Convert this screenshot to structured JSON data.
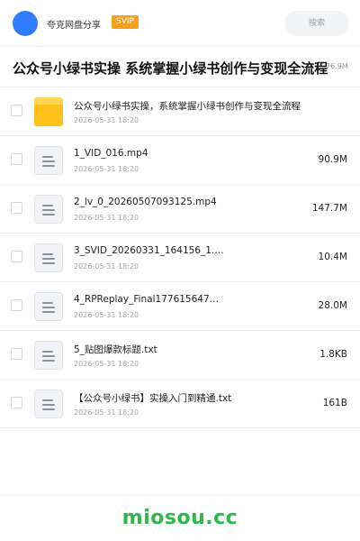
{
  "header": {
    "share_name": "夸克网盘分享",
    "badge": "SVIP",
    "search_placeholder": "搜索",
    "avatar_color": "#2f7bff",
    "badge_color": "#f5a01f"
  },
  "title": {
    "text": "公众号小绿书实操 系统掌握小绿书创作与变现全流程",
    "size": "76.9M"
  },
  "files": [
    {
      "type": "folder",
      "name": "公众号小绿书实操，系统掌握小绿书创作与变现全流程",
      "date": "2026-05-31 18:20",
      "size": ""
    },
    {
      "type": "file",
      "name": "1_VID_016.mp4",
      "date": "2026-05-31 18:20",
      "size": "90.9M"
    },
    {
      "type": "file",
      "name": "2_lv_0_20260507093125.mp4",
      "date": "2026-05-31 18:20",
      "size": "147.7M"
    },
    {
      "type": "file",
      "name": "3_SVID_20260331_164156_1.…",
      "date": "2026-05-31 18:20",
      "size": "10.4M"
    },
    {
      "type": "file",
      "name": "4_RPReplay_Final177615647…",
      "date": "2026-05-31 18:20",
      "size": "28.0M"
    },
    {
      "type": "file",
      "name": "5_贴图爆款标题.txt",
      "date": "2026-05-31 18:20",
      "size": "1.8KB"
    },
    {
      "type": "file",
      "name": "【公众号小绿书】实操入门到精通.txt",
      "date": "2026-05-31 18:20",
      "size": "161B"
    }
  ],
  "watermark": "miosou.cc",
  "colors": {
    "accent_green": "#2db84a",
    "folder_yellow": "#ffc21a"
  }
}
